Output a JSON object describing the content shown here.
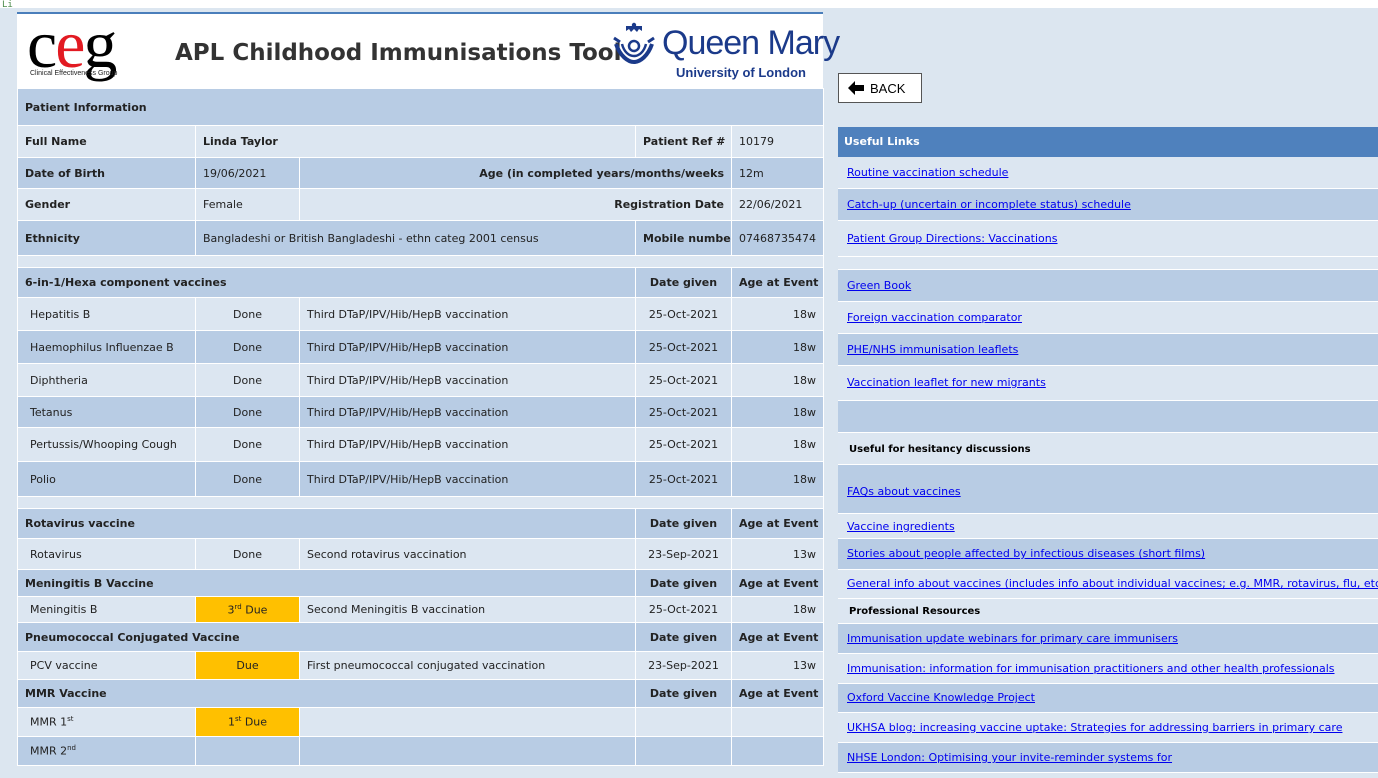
{
  "header": {
    "ceg_logo_text": "ceg",
    "ceg_logo_sub": "Clinical Effectiveness Group",
    "title": "APL Childhood Immunisations Tool",
    "qm_name": "Queen Mary",
    "qm_sub": "University of London"
  },
  "patient": {
    "section_title": "Patient Information",
    "full_name_label": "Full Name",
    "full_name": "Linda Taylor",
    "ref_label": "Patient Ref #",
    "ref": "10179",
    "dob_label": "Date of Birth",
    "dob": "19/06/2021",
    "age_label": "Age (in completed years/months/weeks",
    "age": "12m",
    "gender_label": "Gender",
    "gender": "Female",
    "reg_label": "Registration Date",
    "reg": "22/06/2021",
    "ethnicity_label": "Ethnicity",
    "ethnicity": "Bangladeshi or British Bangladeshi - ethn categ 2001 census",
    "mobile_label": "Mobile number",
    "mobile": "07468735474"
  },
  "columns": {
    "date_given": "Date given",
    "age_at_event": "Age at Event"
  },
  "hexa": {
    "title": "6-in-1/Hexa component vaccines",
    "rows": [
      {
        "name": "Hepatitis B",
        "status": "Done",
        "desc": "Third DTaP/IPV/Hib/HepB vaccination",
        "date": "25-Oct-2021",
        "age": "18w"
      },
      {
        "name": "Haemophilus Influenzae B",
        "status": "Done",
        "desc": "Third DTaP/IPV/Hib/HepB vaccination",
        "date": "25-Oct-2021",
        "age": "18w"
      },
      {
        "name": "Diphtheria",
        "status": "Done",
        "desc": "Third DTaP/IPV/Hib/HepB vaccination",
        "date": "25-Oct-2021",
        "age": "18w"
      },
      {
        "name": "Tetanus",
        "status": "Done",
        "desc": "Third DTaP/IPV/Hib/HepB vaccination",
        "date": "25-Oct-2021",
        "age": "18w"
      },
      {
        "name": "Pertussis/Whooping Cough",
        "status": "Done",
        "desc": "Third DTaP/IPV/Hib/HepB vaccination",
        "date": "25-Oct-2021",
        "age": "18w"
      },
      {
        "name": "Polio",
        "status": "Done",
        "desc": "Third DTaP/IPV/Hib/HepB vaccination",
        "date": "25-Oct-2021",
        "age": "18w"
      }
    ]
  },
  "rota": {
    "title": "Rotavirus vaccine",
    "name": "Rotavirus",
    "status": "Done",
    "desc": "Second rotavirus vaccination",
    "date": "23-Sep-2021",
    "age": "13w"
  },
  "menb": {
    "title": "Meningitis B Vaccine",
    "name": "Meningitis B",
    "status_num": "3",
    "status_sup": "rd",
    "status_text": " Due",
    "desc": "Second Meningitis B vaccination",
    "date": "25-Oct-2021",
    "age": "18w"
  },
  "pcv": {
    "title": "Pneumococcal Conjugated Vaccine",
    "name": "PCV vaccine",
    "status": "Due",
    "desc": "First pneumococcal conjugated vaccination",
    "date": "23-Sep-2021",
    "age": "13w"
  },
  "mmr": {
    "title": "MMR Vaccine",
    "r1_name": "MMR 1",
    "r1_sup": "st",
    "r1_status_num": "1",
    "r1_status_sup": "st",
    "r1_status_text": " Due",
    "r2_name": "MMR 2",
    "r2_sup": "nd"
  },
  "back_label": "BACK",
  "links": {
    "title": "Useful Links",
    "l1": "Routine vaccination schedule ",
    "l2": "Catch-up (uncertain or incomplete status) schedule ",
    "l3": "Patient Group Directions: Vaccinations",
    "l4": "Green Book ",
    "l5": "Foreign vaccination comparator ",
    "l6": "PHE/NHS immunisation leaflets",
    "l7": "Vaccination leaflet for new migrants ",
    "hesitancy_title": "Useful for hesitancy discussions",
    "l8": "FAQs about vaccines",
    "l9": "Vaccine ingredients",
    "l10": "Stories about people affected by infectious diseases (short films)",
    "l11": "General info about vaccines (includes info about individual vaccines; e.g. MMR, rotavirus, flu, etc.)",
    "prof_title": "Professional Resources",
    "l12": "Immunisation update webinars for primary care immunisers",
    "l13": "Immunisation: information for immunisation practitioners and other health professionals",
    "l14": "Oxford Vaccine Knowledge Project",
    "l15": "UKHSA blog: increasing vaccine uptake: Strategies for addressing barriers in primary care",
    "l16": "NHSE London: Optimising your invite-reminder systems for"
  },
  "colors": {
    "header_blue": "#4f81bd",
    "row_light": "#dce6f1",
    "row_dark": "#b8cce4",
    "due_orange": "#ffc000"
  }
}
